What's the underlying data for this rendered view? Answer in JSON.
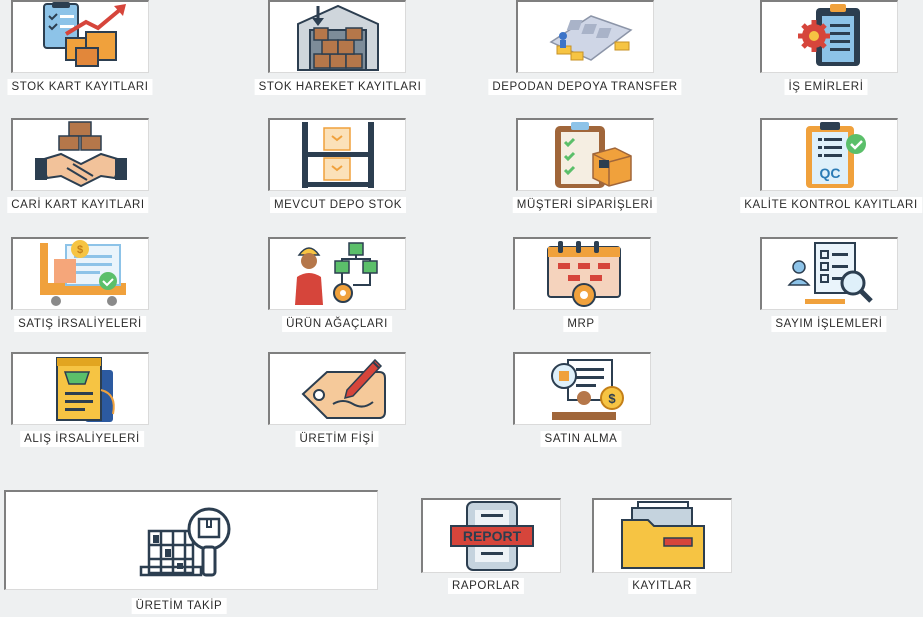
{
  "menu": {
    "stok_kart": {
      "label": "STOK KART KAYITLARI",
      "icon": "inventory-boxes-growth-icon"
    },
    "stok_hareket": {
      "label": "STOK HAREKET KAYITLARI",
      "icon": "warehouse-icon"
    },
    "depo_transfer": {
      "label": "DEPODAN DEPOYA TRANSFER",
      "icon": "pallet-transfer-icon"
    },
    "is_emirleri": {
      "label": "İŞ EMİRLERİ",
      "icon": "clipboard-gear-icon"
    },
    "cari_kart": {
      "label": "CARİ KART KAYITLARI",
      "icon": "handshake-boxes-icon"
    },
    "mevcut_depo": {
      "label": "MEVCUT DEPO STOK",
      "icon": "shelf-boxes-icon"
    },
    "musteri_siparis": {
      "label": "MÜŞTERİ SİPARİŞLERİ",
      "icon": "clipboard-package-icon"
    },
    "kalite_kontrol": {
      "label": "KALİTE KONTROL KAYITLARI",
      "icon": "qc-clipboard-icon",
      "badge": "QC"
    },
    "satis_irsaliye": {
      "label": "SATIŞ İRSALİYELERİ",
      "icon": "cart-invoice-icon"
    },
    "urun_agaci": {
      "label": "ÜRÜN AĞAÇLARI",
      "icon": "worker-flowchart-icon"
    },
    "mrp": {
      "label": "MRP",
      "icon": "calendar-gear-icon"
    },
    "sayim": {
      "label": "SAYIM İŞLEMLERİ",
      "icon": "checklist-magnifier-icon"
    },
    "alis_irsaliye": {
      "label": "ALIŞ İRSALİYELERİ",
      "icon": "shopping-receipt-icon"
    },
    "uretim_fisi": {
      "label": "ÜRETİM FİŞİ",
      "icon": "tag-pen-icon"
    },
    "satin_alma": {
      "label": "SATIN ALMA",
      "icon": "purchase-documents-icon"
    },
    "uretim_takip": {
      "label": "ÜRETİM TAKİP",
      "icon": "production-tracking-icon"
    },
    "raporlar": {
      "label": "RAPORLAR",
      "icon": "report-icon",
      "badge": "REPORT"
    },
    "kayitlar": {
      "label": "KAYITLAR",
      "icon": "folder-icon"
    }
  },
  "colors": {
    "background": "#eef0f1",
    "orange": "#f0a13c",
    "brown": "#a0663a",
    "red": "#d6453b",
    "blue": "#8dc3e8",
    "green": "#5bbf6a",
    "navy": "#2c3e50",
    "yellow": "#f6c443"
  }
}
